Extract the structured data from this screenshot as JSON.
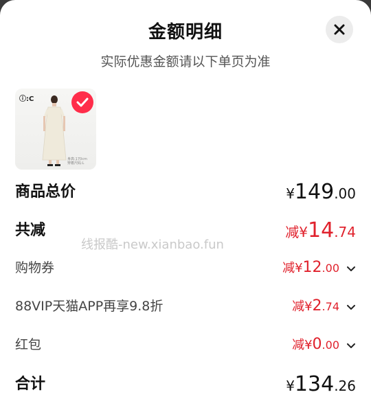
{
  "header": {
    "title": "金额明细",
    "subtitle": "实际优惠金额请以下单页为准"
  },
  "product": {
    "brand": "ⓘ:C",
    "caption_line1": "身高:170cm",
    "caption_line2": "穿着尺码:L",
    "selected": true
  },
  "rows": [
    {
      "label": "商品总价",
      "prefix": "¥",
      "int": "149",
      "dec": ".00",
      "color": "#111111"
    },
    {
      "label": "共减",
      "prefix": "减¥",
      "int": "14",
      "dec": ".74",
      "color": "#e0212c"
    },
    {
      "label": "购物券",
      "prefix": "减¥",
      "int": "12",
      "dec": ".00",
      "color": "#e0212c"
    },
    {
      "label": "88VIP天猫APP再享9.8折",
      "prefix": "减¥",
      "int": "2",
      "dec": ".74",
      "color": "#e0212c"
    },
    {
      "label": "红包",
      "prefix": "减¥",
      "int": "0",
      "dec": ".00",
      "color": "#e0212c"
    },
    {
      "label": "合计",
      "prefix": "¥",
      "int": "134",
      "dec": ".26",
      "color": "#111111"
    }
  ],
  "watermark": "线报酷-new.xianbao.fun",
  "colors": {
    "accent": "#e0212c",
    "check": "#ff2d4a"
  }
}
